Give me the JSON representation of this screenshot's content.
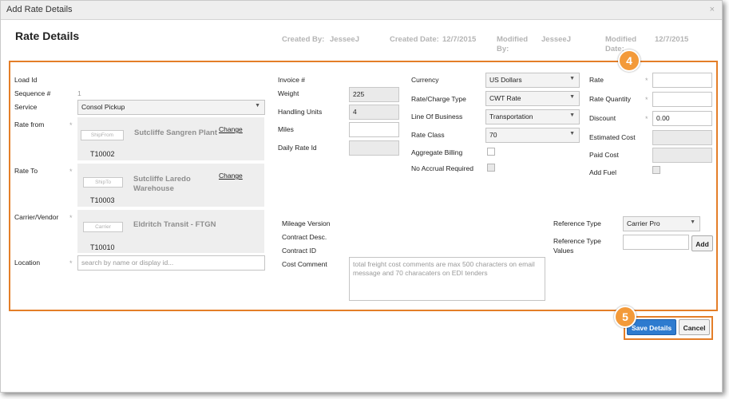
{
  "window": {
    "title": "Add Rate Details",
    "close": "×"
  },
  "header": {
    "title": "Rate Details",
    "created_by_label": "Created By:",
    "created_by": "JesseeJ",
    "created_date_label": "Created Date:",
    "created_date": "12/7/2015",
    "modified_by_label_1": "Modified",
    "modified_by_label_2": "By:",
    "modified_by": "JesseeJ",
    "modified_date_label_1": "Modified",
    "modified_date_label_2": "Date:",
    "modified_date": "12/7/2015"
  },
  "left": {
    "load_id_label": "Load Id",
    "sequence_label": "Sequence #",
    "sequence_value": "1",
    "service_label": "Service",
    "service_value": "Consol Pickup",
    "rate_from_label": "Rate from",
    "rate_from_tag": "ShipFrom",
    "rate_from_name": "Sutcliffe Sangren Plant",
    "rate_from_code": "T10002",
    "rate_to_label": "Rate To",
    "rate_to_tag": "ShipTo",
    "rate_to_name_1": "Sutcliffe Laredo",
    "rate_to_name_2": "Warehouse",
    "rate_to_code": "T10003",
    "carrier_label": "Carrier/Vendor",
    "carrier_tag": "Carrier",
    "carrier_name": "Eldritch Transit - FTGN",
    "carrier_code": "T10010",
    "change_label": "Change",
    "location_label": "Location",
    "location_placeholder": "search by name or display id..."
  },
  "middle": {
    "invoice_label": "Invoice #",
    "weight_label": "Weight",
    "weight_value": "225",
    "handling_label": "Handling Units",
    "handling_value": "4",
    "miles_label": "Miles",
    "daily_rate_label": "Daily Rate Id",
    "mileage_version_label": "Mileage Version",
    "contract_desc_label": "Contract Desc.",
    "contract_id_label": "Contract ID",
    "cost_comment_label": "Cost Comment",
    "cost_comment_placeholder": "total freight cost comments are max 500 characters on email message and 70 characaters on EDI tenders"
  },
  "right_mid": {
    "currency_label": "Currency",
    "currency_value": "US Dollars",
    "rate_charge_label": "Rate/Charge Type",
    "rate_charge_value": "CWT Rate",
    "lob_label": "Line Of Business",
    "lob_value": "Transportation",
    "rate_class_label": "Rate Class",
    "rate_class_value": "70",
    "aggregate_label": "Aggregate Billing",
    "no_accrual_label": "No Accrual Required"
  },
  "right": {
    "rate_label": "Rate",
    "rate_qty_label": "Rate Quantity",
    "discount_label": "Discount",
    "discount_value": "0.00",
    "est_cost_label": "Estimated Cost",
    "paid_cost_label": "Paid Cost",
    "add_fuel_label": "Add Fuel",
    "ref_type_label": "Reference Type",
    "ref_type_value": "Carrier Pro",
    "ref_values_label_1": "Reference Type",
    "ref_values_label_2": "Values",
    "add_button": "Add"
  },
  "footer": {
    "save": "Save Details",
    "cancel": "Cancel"
  },
  "badges": {
    "form": "4",
    "buttons": "5"
  },
  "colors": {
    "accent_orange": "#e47e28",
    "badge_orange": "#f39a3a",
    "save_blue": "#2e7bcf"
  }
}
